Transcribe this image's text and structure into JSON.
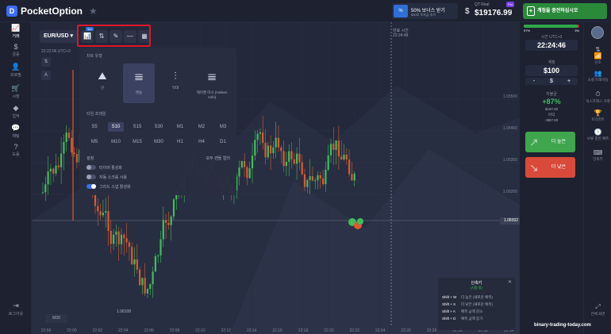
{
  "header": {
    "logo_text": "PocketOption",
    "promo_title": "50% 보너스 받기",
    "promo_sub": "$50로 투자금 추가",
    "account_type": "QT Real",
    "balance": "$19176.99",
    "pro_badge": "Pro",
    "deposit_label": "계정을 충전하십시오"
  },
  "left_nav": [
    {
      "icon": "chart-icon",
      "glyph": "📈",
      "label": "거래"
    },
    {
      "icon": "dollar-icon",
      "glyph": "$",
      "label": "금융"
    },
    {
      "icon": "user-icon",
      "glyph": "👤",
      "label": "프로필"
    },
    {
      "icon": "market-icon",
      "glyph": "🛒",
      "label": "시장"
    },
    {
      "icon": "diamond-icon",
      "glyph": "◆",
      "label": "업적"
    },
    {
      "icon": "chat-icon",
      "glyph": "💬",
      "label": "채팅"
    },
    {
      "icon": "help-icon",
      "glyph": "?",
      "label": "도움"
    },
    {
      "icon": "logout-icon",
      "glyph": "⇥",
      "label": "로그아웃"
    }
  ],
  "toolbar": {
    "pair": "EUR/USD",
    "pair_caret": "▾",
    "badge": "1m",
    "chart_type_glyph": "📊",
    "settings_glyph": "⇅",
    "draw_glyph": "✎",
    "line_glyph": "—",
    "grid_glyph": "▦"
  },
  "chart": {
    "time_info": "22:22:06  UTC+3",
    "chat_badge": "14",
    "vertical_time_label": "만료 시간",
    "vertical_time_value": "22:24:48",
    "current_price": "1.08302",
    "low_price": "1.08108",
    "timeframe_tag": "M30",
    "y_ticks": [
      "1.08500",
      "1.08400",
      "1.08300",
      "1.08200"
    ],
    "x_ticks": [
      "21:58",
      "22:00",
      "22:02",
      "22:04",
      "22:06",
      "22:08",
      "22:10",
      "22:12",
      "22:14",
      "22:16",
      "22:18",
      "22:20",
      "22:22",
      "22:24",
      "22:26",
      "22:28",
      "22:30",
      "22:32",
      "22:34"
    ]
  },
  "settings_panel": {
    "chart_type_title": "차트 유형",
    "chart_types": [
      {
        "label": "선",
        "glyph": "⛰",
        "selected": false
      },
      {
        "label": "캔들",
        "glyph": "𝍣",
        "selected": true
      },
      {
        "label": "막대",
        "glyph": "⫶",
        "selected": false
      },
      {
        "label": "헤이켄 아시 (Heiken Ashi)",
        "glyph": "𝍣",
        "selected": false
      }
    ],
    "timeframe_title": "타임 프레임",
    "timeframes": [
      "S5",
      "S10",
      "S15",
      "S30",
      "M1",
      "M2",
      "M3",
      "M5",
      "M10",
      "M15",
      "M30",
      "H1",
      "H4",
      "D1"
    ],
    "selected_timeframe": "S10",
    "settings_title": "설정",
    "reset_label": "모두 캔들 컬러",
    "toggles": [
      {
        "label": "타이머 활성화",
        "on": false
      },
      {
        "label": "자동 스크롤 사용",
        "on": false
      },
      {
        "label": "그리드 스냅 활성화",
        "on": true
      }
    ]
  },
  "shortcuts": {
    "title": "단축키",
    "subtitle": "(사용 중)",
    "rows": [
      {
        "key": "Shift + W",
        "desc": "더 높은 (새로운 예측)"
      },
      {
        "key": "Shift + S",
        "desc": "더 낮은 (새로운 예측)"
      },
      {
        "key": "Shift + A",
        "desc": "예측 금액 감소"
      },
      {
        "key": "Shift + D",
        "desc": "예측 금액 증가"
      }
    ]
  },
  "trade_panel": {
    "sentiment_up_pct": 97,
    "sentiment_up": "97%",
    "sentiment_down": "3%",
    "time_label": "시간 UTC+3",
    "time_value": "22:24:46",
    "amount_label": "계정",
    "amount_value": "$100",
    "minus": "-",
    "currency": "$",
    "plus": "+",
    "payout_label": "지불금",
    "payout_pct": "+87%",
    "payout_amount": "$187.00",
    "profit_label": "이익",
    "profit_amount": "+$87.00",
    "buy_label": "더 높은",
    "sell_label": "더 낮은"
  },
  "right_nav": [
    {
      "icon": "trades-icon",
      "glyph": "⇅",
      "label": "거래"
    },
    {
      "icon": "signals-icon",
      "glyph": "📶",
      "label": "신호"
    },
    {
      "icon": "social-trading-icon",
      "glyph": "👥",
      "label": "소셜 트레이딩"
    },
    {
      "icon": "express-icon",
      "glyph": "⏱",
      "label": "익스프레스 거래"
    },
    {
      "icon": "tournament-icon",
      "glyph": "🏆",
      "label": "토너먼트"
    },
    {
      "icon": "pending-icon",
      "glyph": "🕓",
      "label": "보류 중인 예측"
    },
    {
      "icon": "hotkeys-icon",
      "glyph": "⌨",
      "label": "단축키"
    },
    {
      "icon": "fullscreen-icon",
      "glyph": "⤢",
      "label": "전체 화면"
    }
  ],
  "watermark": "binary-trading-today.com",
  "colors": {
    "up": "#3fbf5a",
    "down": "#e0572e",
    "accent": "#3b6cf6",
    "highlight_box": "#e0152a"
  }
}
